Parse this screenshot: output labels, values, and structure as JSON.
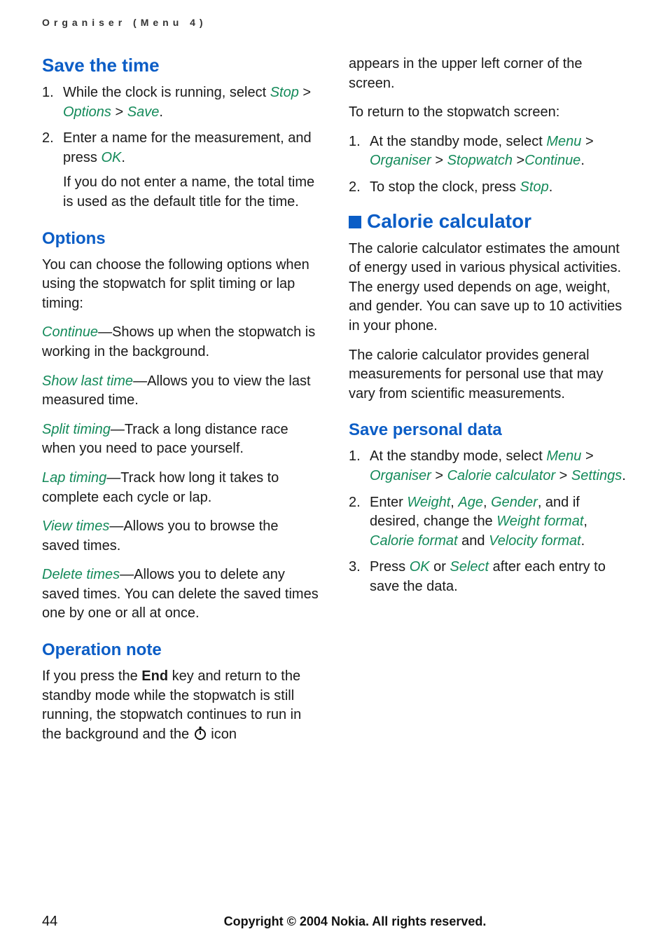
{
  "header": "Organiser (Menu 4)",
  "left": {
    "saveTime": {
      "heading": "Save the time",
      "items": [
        {
          "num": "1.",
          "pre": "While the clock is running, select ",
          "g1": "Stop",
          "sep1": " > ",
          "g2": "Options",
          "sep2": " > ",
          "g3": "Save",
          "post": "."
        },
        {
          "num": "2.",
          "line1a": "Enter a name for the measurement, and press ",
          "line1g": "OK",
          "line1b": ".",
          "line2": "If you do not enter a name, the total time is used as the default title for the time."
        }
      ]
    },
    "options": {
      "heading": "Options",
      "intro": "You can choose the following options when using the stopwatch for split timing or lap timing:",
      "list": [
        {
          "g": "Continue",
          "t": "—Shows up when the stopwatch is working in the background."
        },
        {
          "g": "Show last time",
          "t": "—Allows you to view the last measured time."
        },
        {
          "g": "Split timing",
          "t": "—Track a long distance race when you need to pace yourself."
        },
        {
          "g": "Lap timing",
          "t": "—Track how long it takes to complete each cycle or lap."
        },
        {
          "g": "View times",
          "t": "—Allows you to browse the saved times."
        },
        {
          "g": "Delete times",
          "t": "—Allows you to delete any saved times. You can delete the saved times one by one or all at once."
        }
      ]
    },
    "opNote": {
      "heading": "Operation note",
      "pre": "If you press the ",
      "bold": "End",
      "mid": " key and return to the standby mode while the stopwatch is still running, the stopwatch continues to run in the background and the ",
      "post": " icon"
    }
  },
  "right": {
    "cont1": "appears in the upper left corner of the screen.",
    "cont2": "To return to the stopwatch screen:",
    "contList": [
      {
        "num": "1.",
        "pre": "At the standby mode, select ",
        "g1": "Menu",
        "s1": " > ",
        "g2": "Organiser",
        "s2": " > ",
        "g3": "Stopwatch",
        "s3": " >",
        "g4": "Continue",
        "post": "."
      },
      {
        "num": "2.",
        "pre": "To stop the clock, press ",
        "g1": "Stop",
        "post": "."
      }
    ],
    "calorie": {
      "heading": "Calorie calculator",
      "p1": "The calorie calculator estimates the amount of energy used in various physical activities. The energy used depends on age, weight, and gender. You can save up to 10 activities in your phone.",
      "p2": "The calorie calculator provides general measurements for personal use that may vary from scientific measurements."
    },
    "savePersonal": {
      "heading": "Save personal data",
      "items": [
        {
          "num": "1.",
          "pre": "At the standby mode, select ",
          "g1": "Menu",
          "s1": " > ",
          "g2": "Organiser",
          "s2": " > ",
          "g3": "Calorie calculator",
          "s3": " > ",
          "g4": "Settings",
          "post": "."
        },
        {
          "num": "2.",
          "pre": "Enter ",
          "g1": "Weight",
          "c1": ", ",
          "g2": "Age",
          "c2": ", ",
          "g3": "Gender",
          "mid": ", and if desired, change the ",
          "g4": "Weight format",
          "c3": ", ",
          "g5": "Calorie format",
          "mid2": " and ",
          "g6": "Velocity format",
          "post": "."
        },
        {
          "num": "3.",
          "pre": "Press ",
          "g1": "OK",
          "mid": " or ",
          "g2": "Select",
          "post": " after each entry to save the data."
        }
      ]
    }
  },
  "footer": {
    "page": "44",
    "copy": "Copyright © 2004 Nokia. All rights reserved."
  }
}
